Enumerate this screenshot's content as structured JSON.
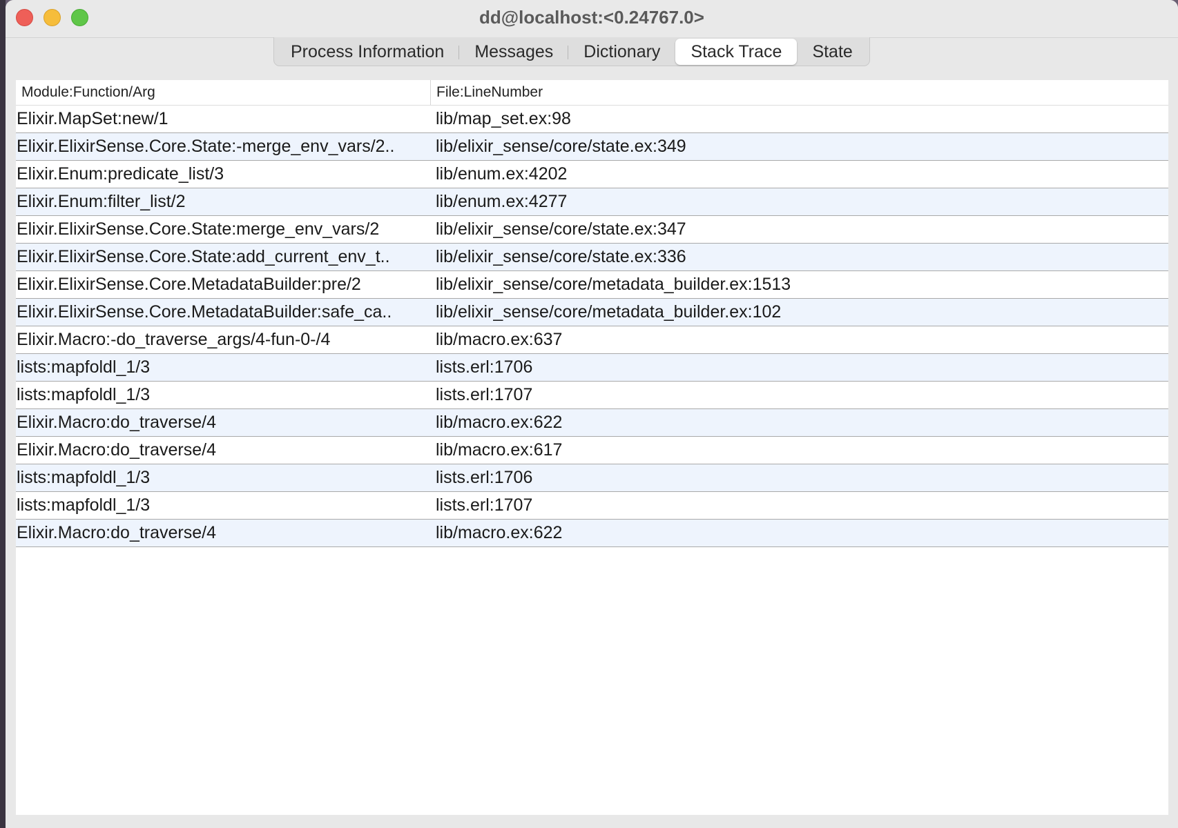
{
  "window": {
    "title": "dd@localhost:<0.24767.0>"
  },
  "tabs": [
    {
      "label": "Process Information",
      "active": false
    },
    {
      "label": "Messages",
      "active": false
    },
    {
      "label": "Dictionary",
      "active": false
    },
    {
      "label": "Stack Trace",
      "active": true
    },
    {
      "label": "State",
      "active": false
    }
  ],
  "table": {
    "columns": [
      "Module:Function/Arg",
      "File:LineNumber"
    ],
    "rows": [
      [
        "Elixir.MapSet:new/1",
        "lib/map_set.ex:98"
      ],
      [
        "Elixir.ElixirSense.Core.State:-merge_env_vars/2..",
        "lib/elixir_sense/core/state.ex:349"
      ],
      [
        "Elixir.Enum:predicate_list/3",
        "lib/enum.ex:4202"
      ],
      [
        "Elixir.Enum:filter_list/2",
        "lib/enum.ex:4277"
      ],
      [
        "Elixir.ElixirSense.Core.State:merge_env_vars/2",
        "lib/elixir_sense/core/state.ex:347"
      ],
      [
        "Elixir.ElixirSense.Core.State:add_current_env_t..",
        "lib/elixir_sense/core/state.ex:336"
      ],
      [
        "Elixir.ElixirSense.Core.MetadataBuilder:pre/2",
        "lib/elixir_sense/core/metadata_builder.ex:1513"
      ],
      [
        "Elixir.ElixirSense.Core.MetadataBuilder:safe_ca..",
        "lib/elixir_sense/core/metadata_builder.ex:102"
      ],
      [
        "Elixir.Macro:-do_traverse_args/4-fun-0-/4",
        "lib/macro.ex:637"
      ],
      [
        "lists:mapfoldl_1/3",
        "lists.erl:1706"
      ],
      [
        "lists:mapfoldl_1/3",
        "lists.erl:1707"
      ],
      [
        "Elixir.Macro:do_traverse/4",
        "lib/macro.ex:622"
      ],
      [
        "Elixir.Macro:do_traverse/4",
        "lib/macro.ex:617"
      ],
      [
        "lists:mapfoldl_1/3",
        "lists.erl:1706"
      ],
      [
        "lists:mapfoldl_1/3",
        "lists.erl:1707"
      ],
      [
        "Elixir.Macro:do_traverse/4",
        "lib/macro.ex:622"
      ]
    ]
  }
}
